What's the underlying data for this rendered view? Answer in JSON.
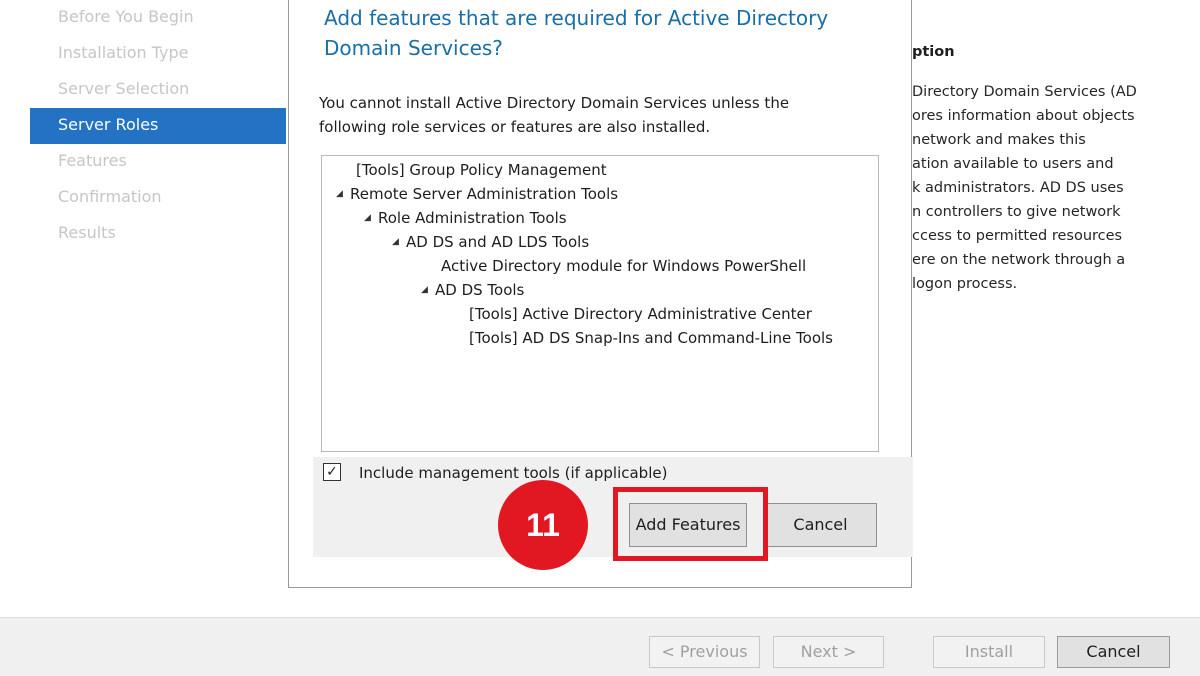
{
  "wizard": {
    "steps": [
      {
        "label": "Before You Begin",
        "active": false
      },
      {
        "label": "Installation Type",
        "active": false
      },
      {
        "label": "Server Selection",
        "active": false
      },
      {
        "label": "Server Roles",
        "active": true
      },
      {
        "label": "Features",
        "active": false
      },
      {
        "label": "Confirmation",
        "active": false
      },
      {
        "label": "Results",
        "active": false
      }
    ],
    "description": {
      "title": "ption",
      "lines": [
        "Directory Domain Services (AD",
        "ores information about objects",
        "network and makes this",
        "ation available to users and",
        "k administrators. AD DS uses",
        "n controllers to give network",
        "ccess to permitted resources",
        "ere on the network through a",
        "logon process."
      ]
    },
    "footer": {
      "previous_label": "< Previous",
      "next_label": "Next >",
      "install_label": "Install",
      "cancel_label": "Cancel"
    }
  },
  "dialog": {
    "title_line1": "Add features that are required for Active Directory",
    "title_line2": "Domain Services?",
    "message_line1": "You cannot install Active Directory Domain Services unless the",
    "message_line2": "following role services or features are also installed.",
    "tree": [
      {
        "label": "[Tools] Group Policy Management",
        "expandable": false,
        "level": 0
      },
      {
        "label": "Remote Server Administration Tools",
        "expandable": true,
        "level": 0
      },
      {
        "label": "Role Administration Tools",
        "expandable": true,
        "level": 1
      },
      {
        "label": "AD DS and AD LDS Tools",
        "expandable": true,
        "level": 2
      },
      {
        "label": "Active Directory module for Windows PowerShell",
        "expandable": false,
        "level": 3
      },
      {
        "label": "AD DS Tools",
        "expandable": true,
        "level": 3
      },
      {
        "label": "[Tools] Active Directory Administrative Center",
        "expandable": false,
        "level": 4
      },
      {
        "label": "[Tools] AD DS Snap-Ins and Command-Line Tools",
        "expandable": false,
        "level": 4
      }
    ],
    "include_tools_label": "Include management tools (if applicable)",
    "include_tools_checked": true,
    "add_features_label": "Add Features",
    "cancel_label": "Cancel"
  },
  "annotation": {
    "step_number": "11",
    "color": "#e11822"
  },
  "colors": {
    "accent": "#2472c4",
    "title_blue": "#1a6ea8"
  }
}
